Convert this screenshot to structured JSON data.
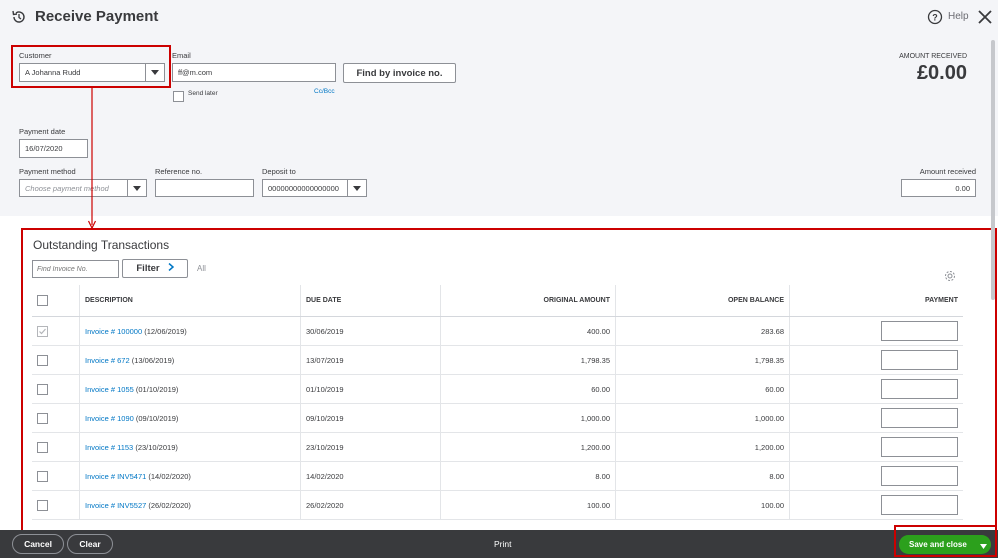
{
  "header": {
    "title": "Receive Payment",
    "help_label": "Help"
  },
  "customer": {
    "label": "Customer",
    "value": "A Johanna Rudd"
  },
  "email": {
    "label": "Email",
    "value": "ff@m.com",
    "send_later_label": "Send later",
    "cc_bcc_label": "Cc/Bcc"
  },
  "find_button_label": "Find by invoice no.",
  "amount_received_summary": {
    "label": "AMOUNT RECEIVED",
    "value": "£0.00"
  },
  "payment_date": {
    "label": "Payment date",
    "value": "16/07/2020"
  },
  "payment_method": {
    "label": "Payment method",
    "placeholder": "Choose payment method"
  },
  "reference": {
    "label": "Reference no.",
    "value": ""
  },
  "deposit_to": {
    "label": "Deposit to",
    "value": "00000000000000000"
  },
  "amount_received_field": {
    "label": "Amount received",
    "value": "0.00"
  },
  "outstanding": {
    "title": "Outstanding Transactions",
    "find_placeholder": "Find Invoice No.",
    "filter_label": "Filter",
    "all_label": "All",
    "columns": {
      "description": "DESCRIPTION",
      "due_date": "DUE DATE",
      "original_amount": "ORIGINAL AMOUNT",
      "open_balance": "OPEN BALANCE",
      "payment": "PAYMENT"
    },
    "rows": [
      {
        "link": "Invoice # 100000",
        "date": "(12/06/2019)",
        "due": "30/06/2019",
        "original": "400.00",
        "open": "283.68",
        "checked": true
      },
      {
        "link": "Invoice # 672",
        "date": "(13/06/2019)",
        "due": "13/07/2019",
        "original": "1,798.35",
        "open": "1,798.35",
        "checked": false
      },
      {
        "link": "Invoice # 1055",
        "date": "(01/10/2019)",
        "due": "01/10/2019",
        "original": "60.00",
        "open": "60.00",
        "checked": false
      },
      {
        "link": "Invoice # 1090",
        "date": "(09/10/2019)",
        "due": "09/10/2019",
        "original": "1,000.00",
        "open": "1,000.00",
        "checked": false
      },
      {
        "link": "Invoice # 1153",
        "date": "(23/10/2019)",
        "due": "23/10/2019",
        "original": "1,200.00",
        "open": "1,200.00",
        "checked": false
      },
      {
        "link": "Invoice # INV5471",
        "date": "(14/02/2020)",
        "due": "14/02/2020",
        "original": "8.00",
        "open": "8.00",
        "checked": false
      },
      {
        "link": "Invoice # INV5527",
        "date": "(26/02/2020)",
        "due": "26/02/2020",
        "original": "100.00",
        "open": "100.00",
        "checked": false
      }
    ]
  },
  "footer": {
    "cancel_label": "Cancel",
    "clear_label": "Clear",
    "print_label": "Print",
    "save_label": "Save and close"
  },
  "colors": {
    "accent_green": "#2ca01c",
    "link_blue": "#0077c5",
    "highlight_red": "#cc0000",
    "footer_bg": "#393a3d"
  }
}
